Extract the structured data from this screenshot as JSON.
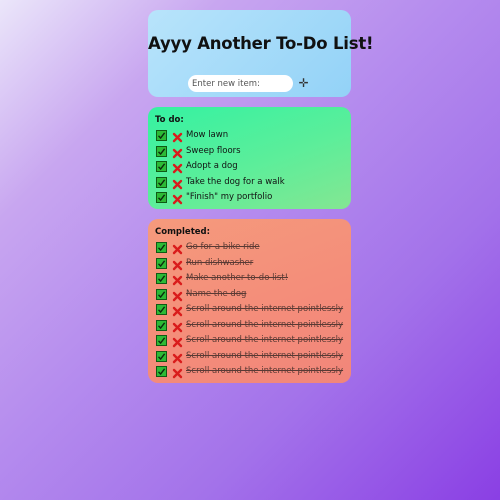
{
  "header": {
    "title": "Ayyy Another To-Do List!",
    "input_placeholder": "Enter new item:",
    "input_value": "",
    "add_icon": "plus-cross-icon"
  },
  "todo": {
    "heading": "To do:",
    "items": [
      {
        "label": "Mow lawn"
      },
      {
        "label": "Sweep floors"
      },
      {
        "label": "Adopt a dog"
      },
      {
        "label": "Take the dog for a walk"
      },
      {
        "label": "\"Finish\" my portfolio"
      }
    ]
  },
  "completed": {
    "heading": "Completed:",
    "items": [
      {
        "label": "Go for a bike ride"
      },
      {
        "label": "Run dishwasher"
      },
      {
        "label": "Make another to-do list!"
      },
      {
        "label": "Name the dog"
      },
      {
        "label": "Scroll around the internet pointlessly"
      },
      {
        "label": "Scroll around the internet pointlessly"
      },
      {
        "label": "Scroll around the internet pointlessly"
      },
      {
        "label": "Scroll around the internet pointlessly"
      },
      {
        "label": "Scroll around the internet pointlessly"
      }
    ]
  },
  "icons": {
    "complete": "green-check-icon",
    "delete": "red-x-icon"
  },
  "colors": {
    "header_panel": "#a7dcf9",
    "todo_panel": "#4ff09c",
    "completed_panel": "#f4907b",
    "check_green": "#2dba36",
    "delete_red": "#d91c1c"
  }
}
